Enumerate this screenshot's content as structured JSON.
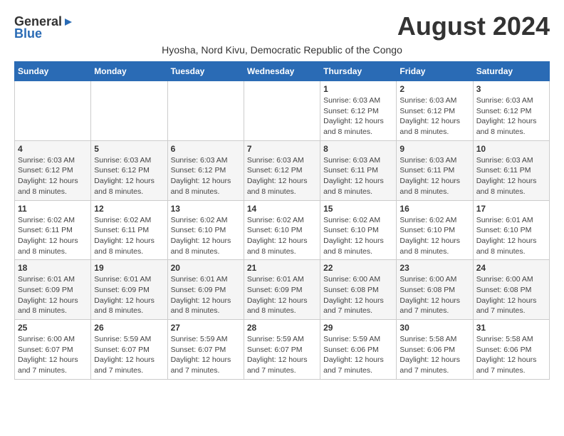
{
  "logo": {
    "general": "General",
    "blue": "Blue"
  },
  "title": "August 2024",
  "subtitle": "Hyosha, Nord Kivu, Democratic Republic of the Congo",
  "weekdays": [
    "Sunday",
    "Monday",
    "Tuesday",
    "Wednesday",
    "Thursday",
    "Friday",
    "Saturday"
  ],
  "weeks": [
    [
      {
        "day": "",
        "info": ""
      },
      {
        "day": "",
        "info": ""
      },
      {
        "day": "",
        "info": ""
      },
      {
        "day": "",
        "info": ""
      },
      {
        "day": "1",
        "info": "Sunrise: 6:03 AM\nSunset: 6:12 PM\nDaylight: 12 hours\nand 8 minutes."
      },
      {
        "day": "2",
        "info": "Sunrise: 6:03 AM\nSunset: 6:12 PM\nDaylight: 12 hours\nand 8 minutes."
      },
      {
        "day": "3",
        "info": "Sunrise: 6:03 AM\nSunset: 6:12 PM\nDaylight: 12 hours\nand 8 minutes."
      }
    ],
    [
      {
        "day": "4",
        "info": "Sunrise: 6:03 AM\nSunset: 6:12 PM\nDaylight: 12 hours\nand 8 minutes."
      },
      {
        "day": "5",
        "info": "Sunrise: 6:03 AM\nSunset: 6:12 PM\nDaylight: 12 hours\nand 8 minutes."
      },
      {
        "day": "6",
        "info": "Sunrise: 6:03 AM\nSunset: 6:12 PM\nDaylight: 12 hours\nand 8 minutes."
      },
      {
        "day": "7",
        "info": "Sunrise: 6:03 AM\nSunset: 6:12 PM\nDaylight: 12 hours\nand 8 minutes."
      },
      {
        "day": "8",
        "info": "Sunrise: 6:03 AM\nSunset: 6:11 PM\nDaylight: 12 hours\nand 8 minutes."
      },
      {
        "day": "9",
        "info": "Sunrise: 6:03 AM\nSunset: 6:11 PM\nDaylight: 12 hours\nand 8 minutes."
      },
      {
        "day": "10",
        "info": "Sunrise: 6:03 AM\nSunset: 6:11 PM\nDaylight: 12 hours\nand 8 minutes."
      }
    ],
    [
      {
        "day": "11",
        "info": "Sunrise: 6:02 AM\nSunset: 6:11 PM\nDaylight: 12 hours\nand 8 minutes."
      },
      {
        "day": "12",
        "info": "Sunrise: 6:02 AM\nSunset: 6:11 PM\nDaylight: 12 hours\nand 8 minutes."
      },
      {
        "day": "13",
        "info": "Sunrise: 6:02 AM\nSunset: 6:10 PM\nDaylight: 12 hours\nand 8 minutes."
      },
      {
        "day": "14",
        "info": "Sunrise: 6:02 AM\nSunset: 6:10 PM\nDaylight: 12 hours\nand 8 minutes."
      },
      {
        "day": "15",
        "info": "Sunrise: 6:02 AM\nSunset: 6:10 PM\nDaylight: 12 hours\nand 8 minutes."
      },
      {
        "day": "16",
        "info": "Sunrise: 6:02 AM\nSunset: 6:10 PM\nDaylight: 12 hours\nand 8 minutes."
      },
      {
        "day": "17",
        "info": "Sunrise: 6:01 AM\nSunset: 6:10 PM\nDaylight: 12 hours\nand 8 minutes."
      }
    ],
    [
      {
        "day": "18",
        "info": "Sunrise: 6:01 AM\nSunset: 6:09 PM\nDaylight: 12 hours\nand 8 minutes."
      },
      {
        "day": "19",
        "info": "Sunrise: 6:01 AM\nSunset: 6:09 PM\nDaylight: 12 hours\nand 8 minutes."
      },
      {
        "day": "20",
        "info": "Sunrise: 6:01 AM\nSunset: 6:09 PM\nDaylight: 12 hours\nand 8 minutes."
      },
      {
        "day": "21",
        "info": "Sunrise: 6:01 AM\nSunset: 6:09 PM\nDaylight: 12 hours\nand 8 minutes."
      },
      {
        "day": "22",
        "info": "Sunrise: 6:00 AM\nSunset: 6:08 PM\nDaylight: 12 hours\nand 7 minutes."
      },
      {
        "day": "23",
        "info": "Sunrise: 6:00 AM\nSunset: 6:08 PM\nDaylight: 12 hours\nand 7 minutes."
      },
      {
        "day": "24",
        "info": "Sunrise: 6:00 AM\nSunset: 6:08 PM\nDaylight: 12 hours\nand 7 minutes."
      }
    ],
    [
      {
        "day": "25",
        "info": "Sunrise: 6:00 AM\nSunset: 6:07 PM\nDaylight: 12 hours\nand 7 minutes."
      },
      {
        "day": "26",
        "info": "Sunrise: 5:59 AM\nSunset: 6:07 PM\nDaylight: 12 hours\nand 7 minutes."
      },
      {
        "day": "27",
        "info": "Sunrise: 5:59 AM\nSunset: 6:07 PM\nDaylight: 12 hours\nand 7 minutes."
      },
      {
        "day": "28",
        "info": "Sunrise: 5:59 AM\nSunset: 6:07 PM\nDaylight: 12 hours\nand 7 minutes."
      },
      {
        "day": "29",
        "info": "Sunrise: 5:59 AM\nSunset: 6:06 PM\nDaylight: 12 hours\nand 7 minutes."
      },
      {
        "day": "30",
        "info": "Sunrise: 5:58 AM\nSunset: 6:06 PM\nDaylight: 12 hours\nand 7 minutes."
      },
      {
        "day": "31",
        "info": "Sunrise: 5:58 AM\nSunset: 6:06 PM\nDaylight: 12 hours\nand 7 minutes."
      }
    ]
  ]
}
